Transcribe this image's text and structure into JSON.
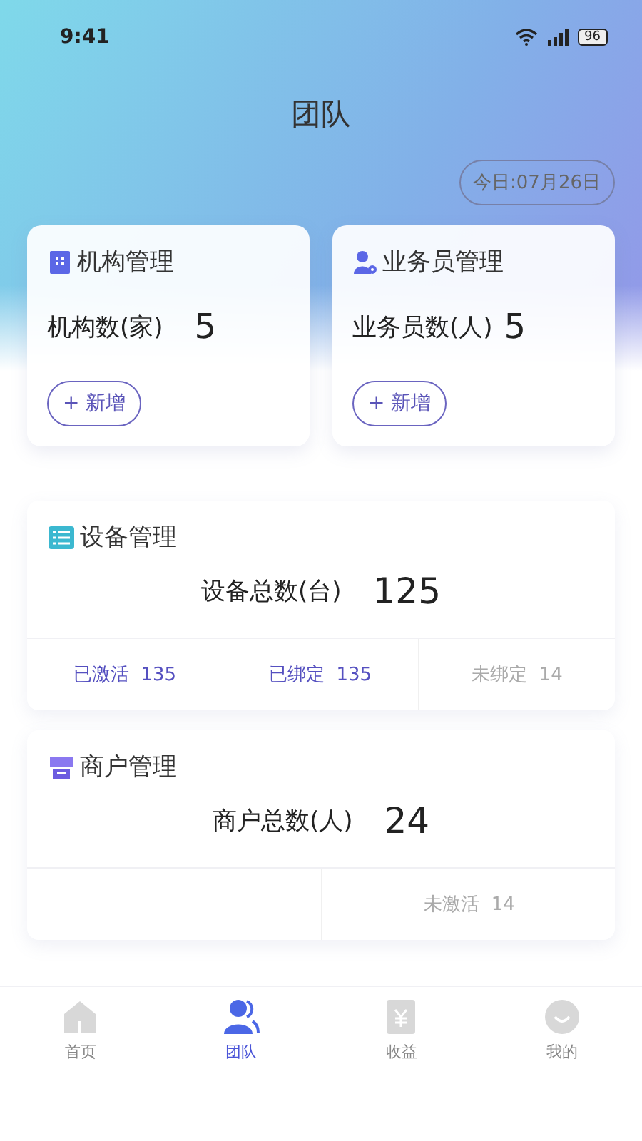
{
  "status_bar": {
    "time": "9:41",
    "battery": "96"
  },
  "title": "团队",
  "date": "今日:07月26日",
  "top_cards": [
    {
      "kind": "org",
      "title": "机构管理",
      "label": "机构数(家)",
      "value": "5",
      "button": "+ 新增"
    },
    {
      "kind": "staff",
      "title": "业务员管理",
      "label": "业务员数(人)",
      "value": "5",
      "button": "+ 新增"
    }
  ],
  "sections": [
    {
      "kind": "device",
      "title": "设备管理",
      "label": "设备总数(台)",
      "value": "125",
      "stats": [
        {
          "label": "已激活",
          "value": "135",
          "highlighted": true
        },
        {
          "label": "已绑定",
          "value": "135",
          "highlighted": true
        },
        {
          "label": "未绑定",
          "value": "14",
          "highlighted": false
        }
      ]
    },
    {
      "kind": "merchant",
      "title": "商户管理",
      "label": "商户总数(人)",
      "value": "24",
      "stats": [
        {
          "label": "未激活",
          "value": "14",
          "highlighted": false
        }
      ]
    }
  ],
  "tabs": [
    {
      "kind": "home",
      "label": "首页",
      "selected": false
    },
    {
      "kind": "team",
      "label": "团队",
      "selected": true
    },
    {
      "kind": "income",
      "label": "收益",
      "selected": false
    },
    {
      "kind": "me",
      "label": "我的",
      "selected": false
    }
  ]
}
